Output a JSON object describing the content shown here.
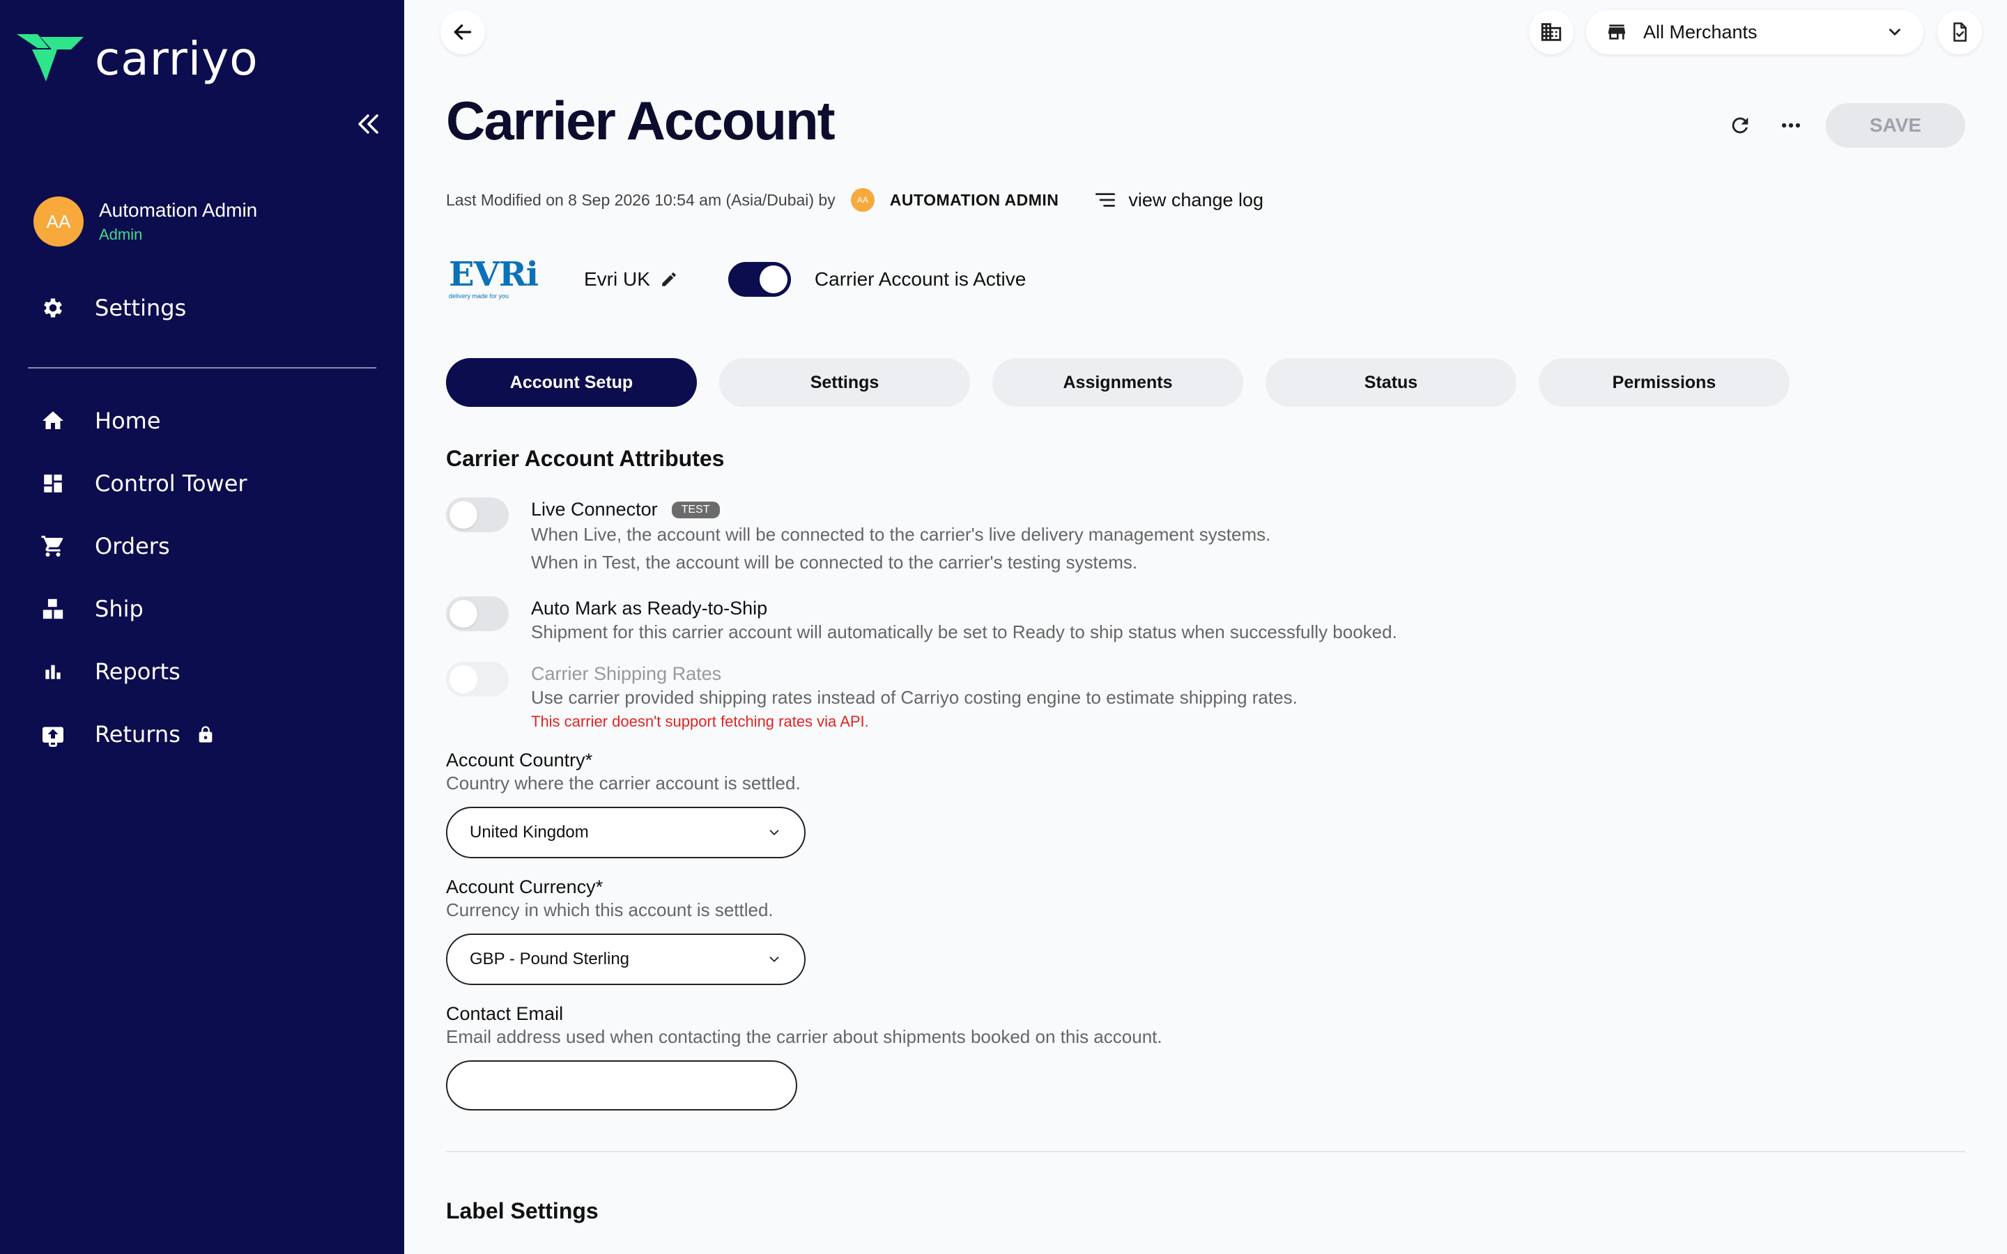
{
  "app": {
    "brand": "carriyo",
    "colors": {
      "sidebar": "#0c0d4e",
      "accent_green": "#2ee58c",
      "avatar": "#f7a93b",
      "warning": "#e02424"
    }
  },
  "sidebar": {
    "user": {
      "initials": "AA",
      "name": "Automation Admin",
      "role": "Admin"
    },
    "settings_label": "Settings",
    "items": [
      {
        "label": "Home",
        "icon": "home-icon"
      },
      {
        "label": "Control Tower",
        "icon": "dashboard-icon"
      },
      {
        "label": "Orders",
        "icon": "cart-icon"
      },
      {
        "label": "Ship",
        "icon": "boxes-icon"
      },
      {
        "label": "Reports",
        "icon": "bar-chart-icon"
      },
      {
        "label": "Returns",
        "icon": "return-box-icon",
        "locked": true
      }
    ]
  },
  "topbar": {
    "merchant_select": "All Merchants"
  },
  "header": {
    "title": "Carrier Account",
    "save_label": "SAVE",
    "meta_text": "Last Modified on 8 Sep 2026 10:54 am (Asia/Dubai) by",
    "modified_by_initials": "AA",
    "modified_by": "AUTOMATION ADMIN",
    "change_log_label": "view change log"
  },
  "carrier": {
    "logo_word": "EVRi",
    "logo_tagline": "delivery made for you",
    "name": "Evri UK",
    "active_label": "Carrier Account is Active",
    "active": true
  },
  "tabs": [
    {
      "label": "Account Setup",
      "active": true
    },
    {
      "label": "Settings",
      "active": false
    },
    {
      "label": "Assignments",
      "active": false
    },
    {
      "label": "Status",
      "active": false
    },
    {
      "label": "Permissions",
      "active": false
    }
  ],
  "attributes": {
    "section_title": "Carrier Account Attributes",
    "live_connector": {
      "title": "Live Connector",
      "badge": "TEST",
      "desc1": "When Live, the account will be connected to the carrier's live delivery management systems.",
      "desc2": "When in Test, the account will be connected to the carrier's testing systems."
    },
    "auto_mark": {
      "title": "Auto Mark as Ready-to-Ship",
      "desc": "Shipment for this carrier account will automatically be set to Ready to ship status when successfully booked."
    },
    "shipping_rates": {
      "title": "Carrier Shipping Rates",
      "desc": "Use carrier provided shipping rates instead of Carriyo costing engine to estimate shipping rates.",
      "warning": "This carrier doesn't support fetching rates via API."
    }
  },
  "fields": {
    "country": {
      "label": "Account Country*",
      "help": "Country where the carrier account is settled.",
      "value": "United Kingdom"
    },
    "currency": {
      "label": "Account Currency*",
      "help": "Currency in which this account is settled.",
      "value": "GBP - Pound Sterling"
    },
    "email": {
      "label": "Contact Email",
      "help": "Email address used when contacting the carrier about shipments booked on this account.",
      "value": ""
    }
  },
  "label_settings": {
    "title": "Label Settings"
  }
}
